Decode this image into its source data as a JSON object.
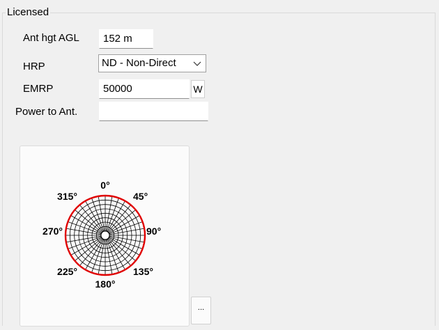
{
  "group": {
    "title": "Licensed"
  },
  "ant_height": {
    "label": "Ant hgt AGL",
    "value": "152 m"
  },
  "hrp": {
    "label": "HRP",
    "selected": "ND - Non-Direct"
  },
  "emrp": {
    "label": "EMRP",
    "value": "50000",
    "unit_button": "W"
  },
  "power": {
    "label": "Power to Ant.",
    "value": ""
  },
  "pattern": {
    "labels": {
      "d0": "0°",
      "d45": "45°",
      "d90": "90°",
      "d135": "135°",
      "d180": "180°",
      "d225": "225°",
      "d270": "270°",
      "d315": "315°"
    },
    "outline_color": "#e00000"
  },
  "more_button": {
    "label": "..."
  }
}
